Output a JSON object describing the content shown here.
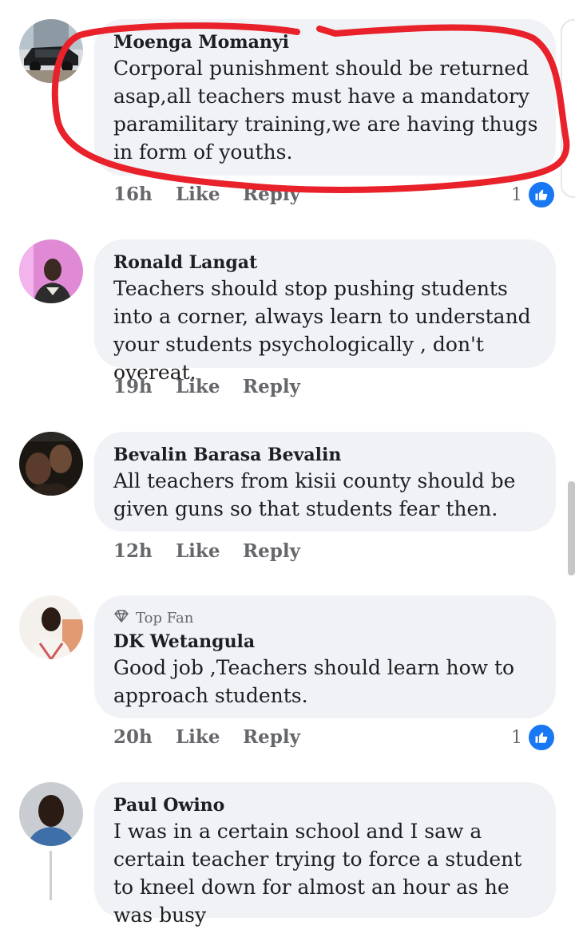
{
  "comments": [
    {
      "author": "Moenga Momanyi",
      "text": "Corporal punishment should be returned asap,all teachers must have a mandatory paramilitary training,we are having thugs in form of youths.",
      "time": "16h",
      "like": "Like",
      "reply": "Reply",
      "reactions": "1"
    },
    {
      "author": "Ronald Langat",
      "text": "Teachers should stop pushing students into a corner, always learn to understand your students psychologically  , don't  overeat.",
      "time": "19h",
      "like": "Like",
      "reply": "Reply"
    },
    {
      "author": "Bevalin Barasa Bevalin",
      "text": "All teachers from kisii county should be given guns so that students fear then.",
      "time": "12h",
      "like": "Like",
      "reply": "Reply"
    },
    {
      "badge": "Top Fan",
      "author": "DK Wetangula",
      "text": "Good job ,Teachers should learn how to approach students.",
      "time": "20h",
      "like": "Like",
      "reply": "Reply",
      "reactions": "1"
    },
    {
      "author": "Paul Owino",
      "text": "I was in a certain school and I saw a certain teacher trying to force a student to kneel down for almost an hour as he was busy"
    }
  ],
  "colors": {
    "accent": "#1877f2",
    "bubble": "#f0f2f5",
    "annotation": "#e8212a"
  },
  "icons": {
    "like": "thumbs-up-icon",
    "top_fan": "diamond-icon"
  }
}
